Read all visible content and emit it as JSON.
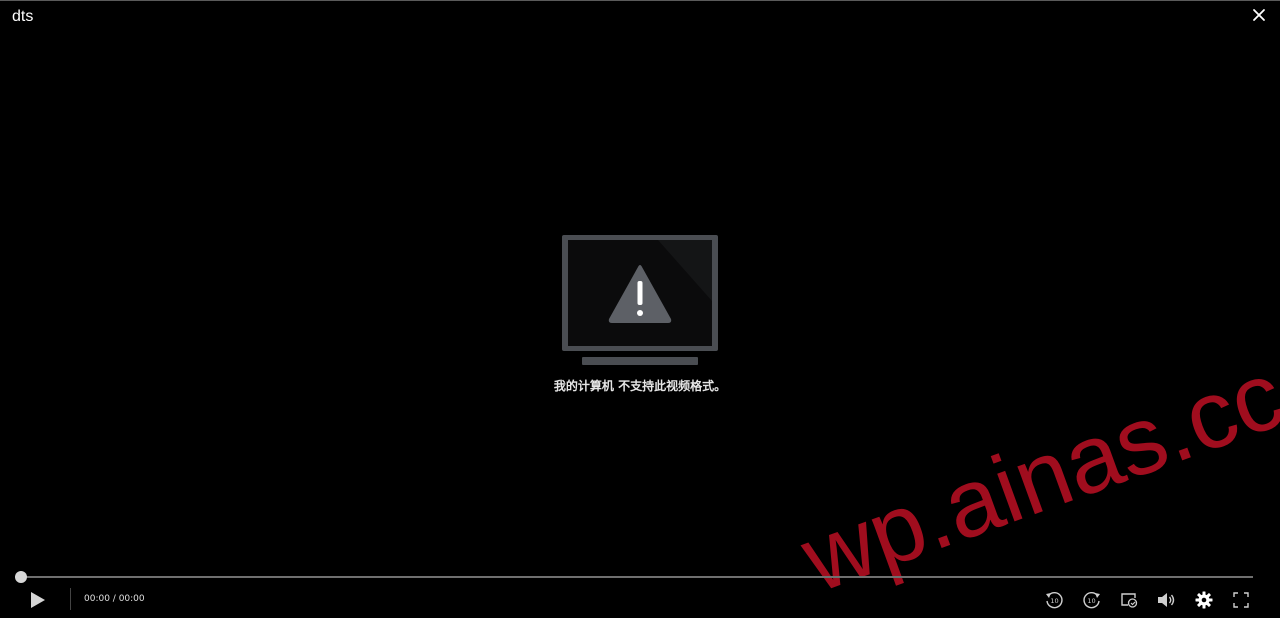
{
  "window": {
    "title": "dts"
  },
  "error": {
    "message": "我的计算机 不支持此视频格式。"
  },
  "playback": {
    "time_display": "00:00 / 00:00",
    "progress": 0
  },
  "controls": {
    "rewind_seconds": "10",
    "forward_seconds": "10"
  },
  "watermark": {
    "text": "wp.ainas.cc",
    "color": "#a00d1e"
  },
  "icons": {
    "close": "close-icon",
    "monitor": "monitor-warning-icon",
    "play": "play-icon",
    "rewind": "rewind-10-icon",
    "forward": "forward-10-icon",
    "repeat": "loop-icon",
    "volume": "volume-icon",
    "settings": "gear-icon",
    "fullscreen": "fullscreen-icon"
  }
}
